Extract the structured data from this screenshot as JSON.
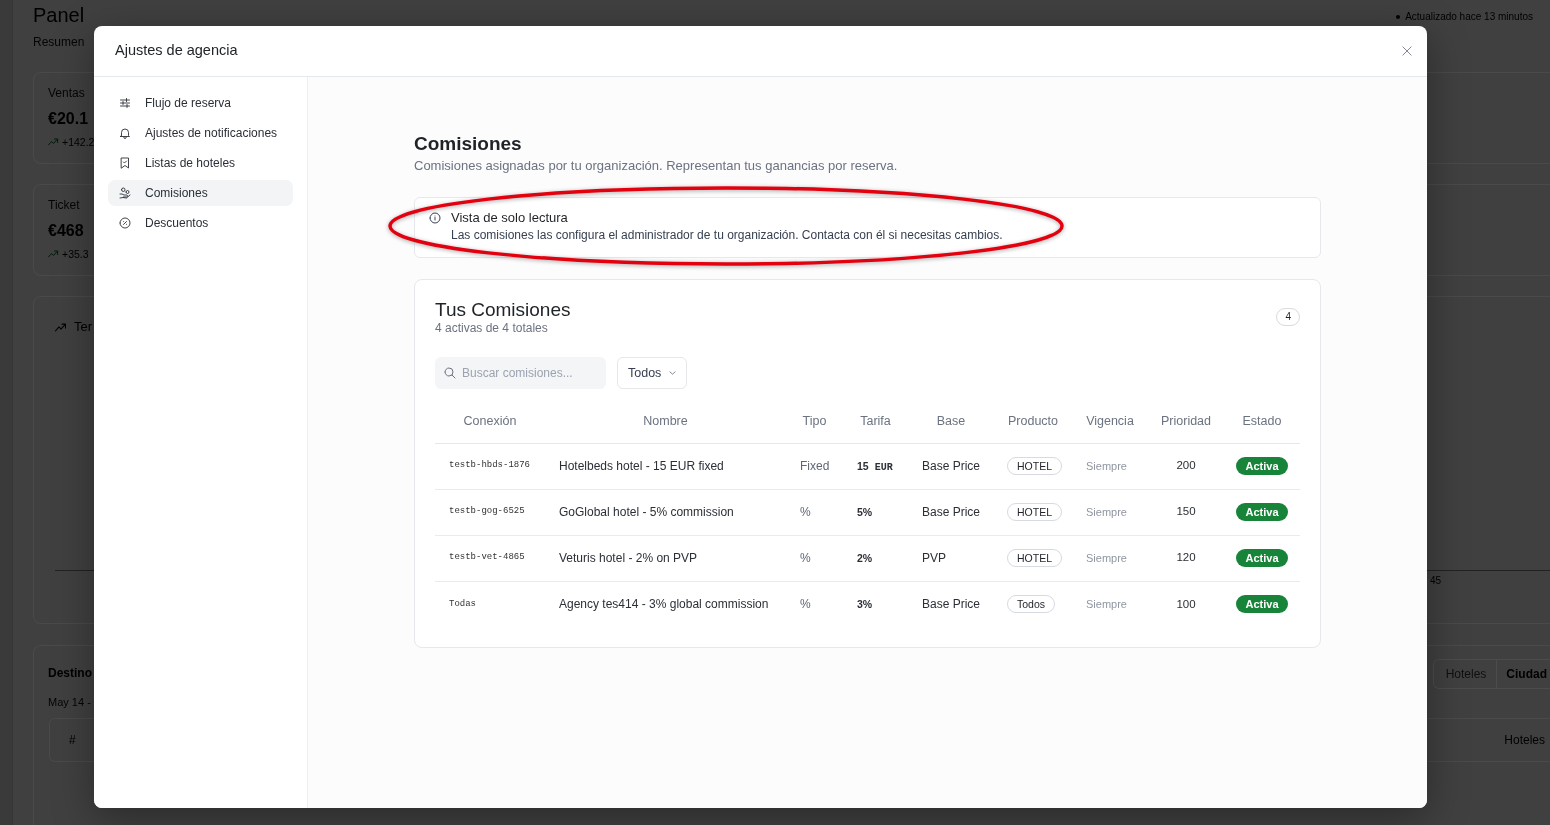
{
  "background_page": {
    "title": "Panel",
    "subtitle": "Resumen",
    "updated": "Actualizado hace 13 minutos",
    "stat_cards": [
      {
        "label": "Ventas",
        "value": "€20.1",
        "change": "+142.2"
      },
      {
        "label": "Ticket",
        "value": "€468",
        "change": "+35.3"
      }
    ],
    "trend_card": {
      "title": "Ter",
      "axis_label": "45"
    },
    "destinations_card": {
      "title": "Destino",
      "period": "May 14 -",
      "toggle": [
        {
          "label": "Hoteles",
          "selected": false
        },
        {
          "label": "Ciudad",
          "selected": true
        }
      ],
      "columns": [
        "#",
        "Hoteles"
      ]
    }
  },
  "modal": {
    "title": "Ajustes de agencia",
    "nav": [
      {
        "label": "Flujo de reserva",
        "selected": false
      },
      {
        "label": "Ajustes de notificaciones",
        "selected": false
      },
      {
        "label": "Listas de hoteles",
        "selected": false
      },
      {
        "label": "Comisiones",
        "selected": true
      },
      {
        "label": "Descuentos",
        "selected": false
      }
    ],
    "section": {
      "title": "Comisiones",
      "subtitle": "Comisiones asignadas por tu organización. Representan tus ganancias por reserva."
    },
    "notice": {
      "title": "Vista de solo lectura",
      "text": "Las comisiones las configura el administrador de tu organización. Contacta con él si necesitas cambios."
    },
    "commissions": {
      "title": "Tus Comisiones",
      "summary": "4 activas de 4 totales",
      "count": "4",
      "search": {
        "placeholder": "Buscar comisiones..."
      },
      "filter": "Todos",
      "columns": [
        "Conexión",
        "Nombre",
        "Tipo",
        "Tarifa",
        "Base",
        "Producto",
        "Vigencia",
        "Prioridad",
        "Estado"
      ],
      "rows": [
        {
          "connection": "testb-hbds-1876",
          "name": "Hotelbeds hotel - 15 EUR fixed",
          "type": "Fixed",
          "rate": "15",
          "currency": "EUR",
          "base": "Base Price",
          "product": "HOTEL",
          "validity": "Siempre",
          "priority": "200",
          "status": "Activa"
        },
        {
          "connection": "testb-gog-6525",
          "name": "GoGlobal hotel - 5% commission",
          "type": "%",
          "rate": "5%",
          "base": "Base Price",
          "product": "HOTEL",
          "validity": "Siempre",
          "priority": "150",
          "status": "Activa"
        },
        {
          "connection": "testb-vet-4865",
          "name": "Veturis hotel - 2% on PVP",
          "type": "%",
          "rate": "2%",
          "base": "PVP",
          "product": "HOTEL",
          "validity": "Siempre",
          "priority": "120",
          "status": "Activa"
        },
        {
          "connection": "Todas",
          "name": "Agency tes414 - 3% global commission",
          "type": "%",
          "rate": "3%",
          "base": "Base Price",
          "product": "Todos",
          "validity": "Siempre",
          "priority": "100",
          "status": "Activa"
        }
      ]
    }
  }
}
